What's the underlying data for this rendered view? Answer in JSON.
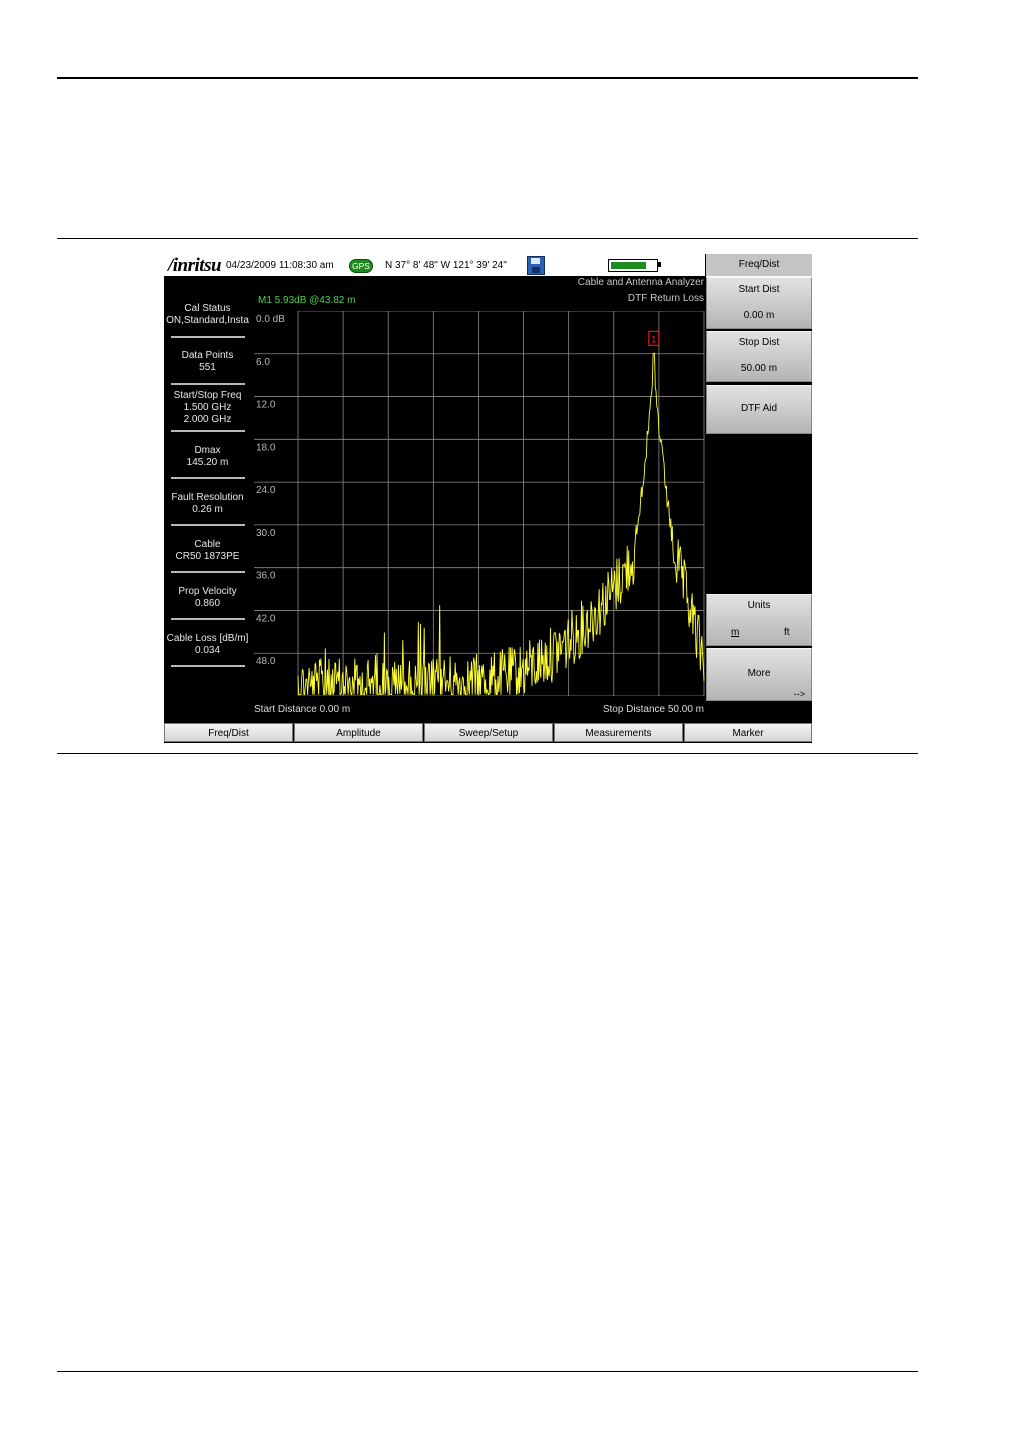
{
  "header": {
    "brand": "/inritsu",
    "datetime": "04/23/2009 11:08:30 am",
    "gps": "GPS",
    "coordinates": "N 37° 8' 48\" W 121° 39' 24\"",
    "battery_level": 0.8
  },
  "mode": {
    "line1": "Cable and Antenna Analyzer",
    "line2": "DTF Return Loss"
  },
  "marker_readout": "M1 5.93dB @43.82 m",
  "params": [
    {
      "label": "Cal Status",
      "value": "ON,Standard,Insta"
    },
    {
      "label": "Data Points",
      "value": "551"
    },
    {
      "label": "Start/Stop Freq",
      "value": "1.500 GHz",
      "value2": "2.000 GHz"
    },
    {
      "label": "Dmax",
      "value": "145.20 m"
    },
    {
      "label": "Fault Resolution",
      "value": "0.26 m"
    },
    {
      "label": "Cable",
      "value": "CR50 1873PE"
    },
    {
      "label": "Prop Velocity",
      "value": "0.860"
    },
    {
      "label": "Cable Loss [dB/m]",
      "value": "0.034"
    }
  ],
  "chart_data": {
    "type": "line",
    "y_tick_labels": [
      "0.0 dB",
      "6.0",
      "12.0",
      "18.0",
      "24.0",
      "30.0",
      "36.0",
      "42.0",
      "48.0"
    ],
    "ylim": [
      0,
      54
    ],
    "xlim": [
      0,
      50
    ],
    "y_inverted": true,
    "grid": true,
    "series_color": "#ffff33",
    "marker": {
      "label": "1",
      "x": 43.82,
      "y": 5.93
    },
    "start_label": "Start Distance 0.00 m",
    "stop_label": "Stop Distance 50.00 m"
  },
  "softkeys": {
    "title": "Freq/Dist",
    "start_dist": {
      "label": "Start Dist",
      "value": "0.00 m"
    },
    "stop_dist": {
      "label": "Stop Dist",
      "value": "50.00 m"
    },
    "dtf_aid": "DTF Aid",
    "units": {
      "label": "Units",
      "m": "m",
      "ft": "ft"
    },
    "more": {
      "label": "More",
      "arrow": "-->"
    }
  },
  "tabs": [
    "Freq/Dist",
    "Amplitude",
    "Sweep/Setup",
    "Measurements",
    "Marker"
  ]
}
